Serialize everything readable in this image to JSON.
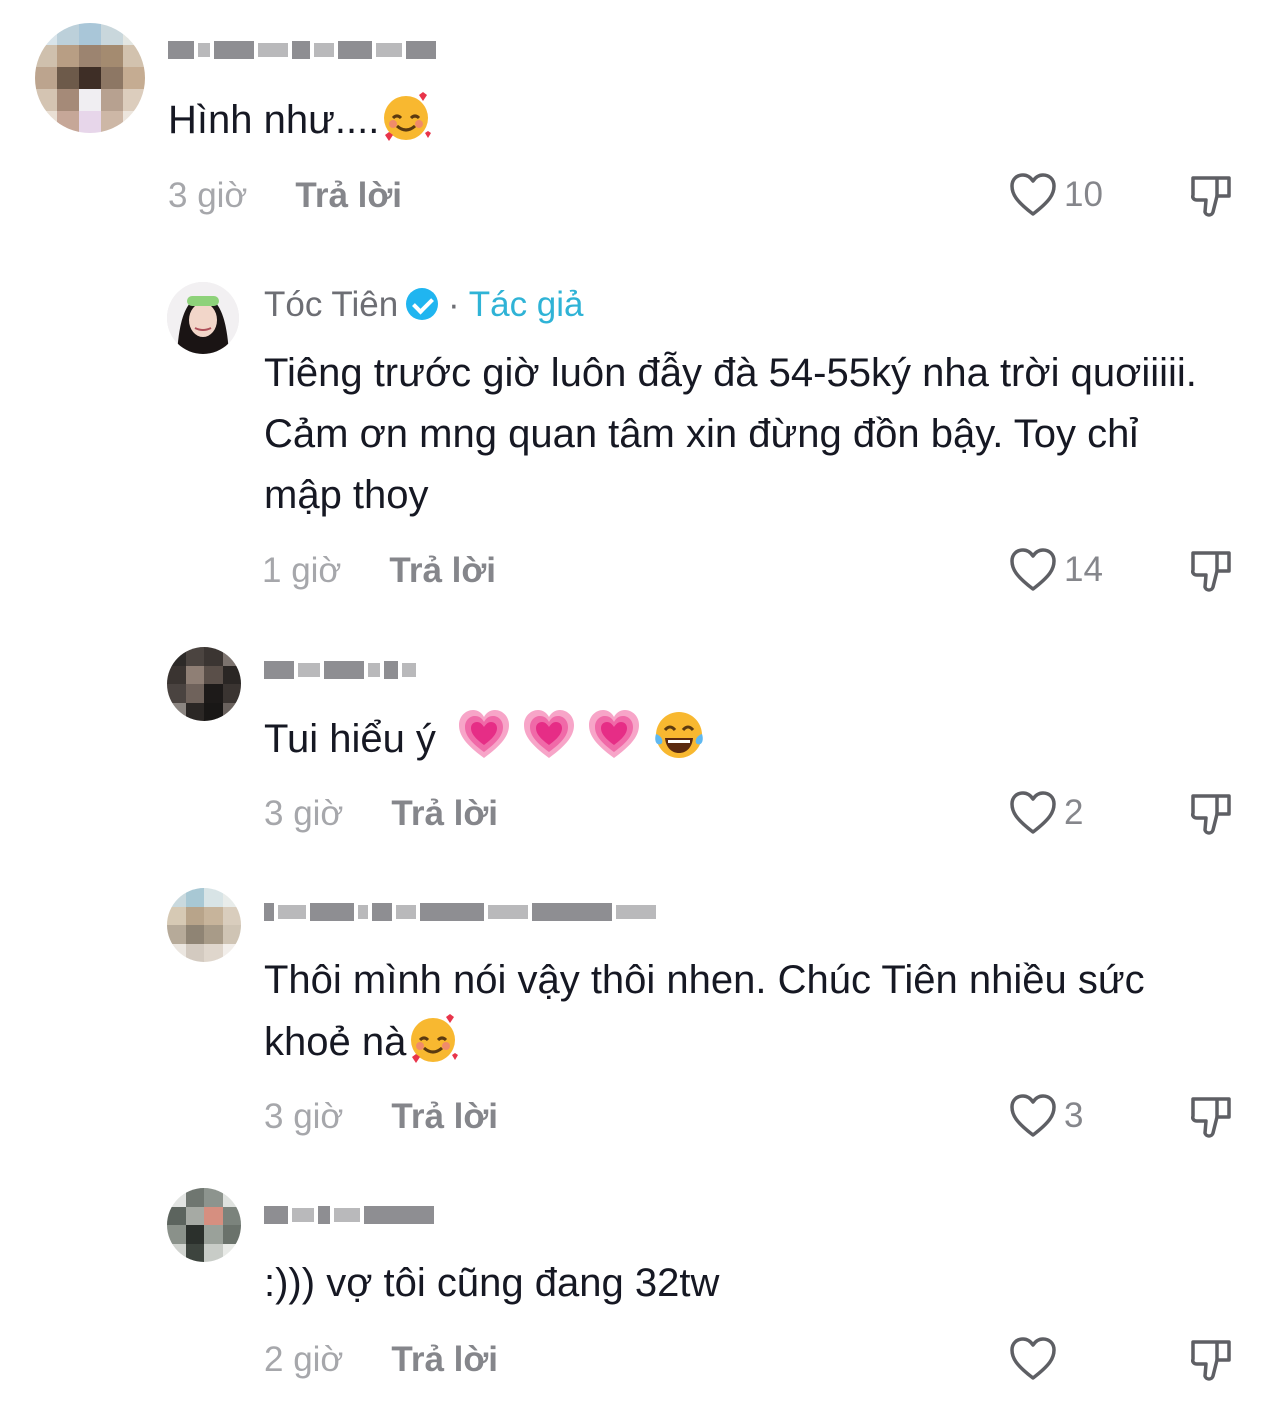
{
  "comments": [
    {
      "username_hidden": true,
      "text": "Hình như....",
      "emoji": "🥰",
      "time": "3 giờ",
      "reply_label": "Trả lời",
      "likes": "10"
    },
    {
      "username": "Tóc Tiên",
      "verified": true,
      "separator": "·",
      "author_tag": "Tác giả",
      "text": "Tiêng trước giờ luôn đẫy đà 54-55ký nha trời quơiiiii. Cảm ơn mng quan tâm xin đừng đồn bậy. Toy chỉ mập thoy",
      "time": "1 giờ",
      "reply_label": "Trả lời",
      "likes": "14"
    },
    {
      "username_hidden": true,
      "text": "Tui hiểu ý",
      "emoji": "💗💗💗😂",
      "time": "3 giờ",
      "reply_label": "Trả lời",
      "likes": "2"
    },
    {
      "username_hidden": true,
      "text": "Thôi mình nói vậy thôi nhen. Chúc Tiên nhiều sức khoẻ nà",
      "emoji": "🥰",
      "time": "3 giờ",
      "reply_label": "Trả lời",
      "likes": "3"
    },
    {
      "username_hidden": true,
      "text": ":))) vợ tôi cũng đang 32tw",
      "time": "2 giờ",
      "reply_label": "Trả lời",
      "likes": ""
    }
  ],
  "colors": {
    "author_tag": "#2fb3d6",
    "verified_badge": "#20b5f0",
    "text": "#161823",
    "secondary": "#85868b"
  },
  "icons": [
    "heart-outline-icon",
    "dislike-icon",
    "verified-icon",
    "smiling-face-with-hearts-icon",
    "growing-heart-icon",
    "tears-of-joy-icon"
  ]
}
